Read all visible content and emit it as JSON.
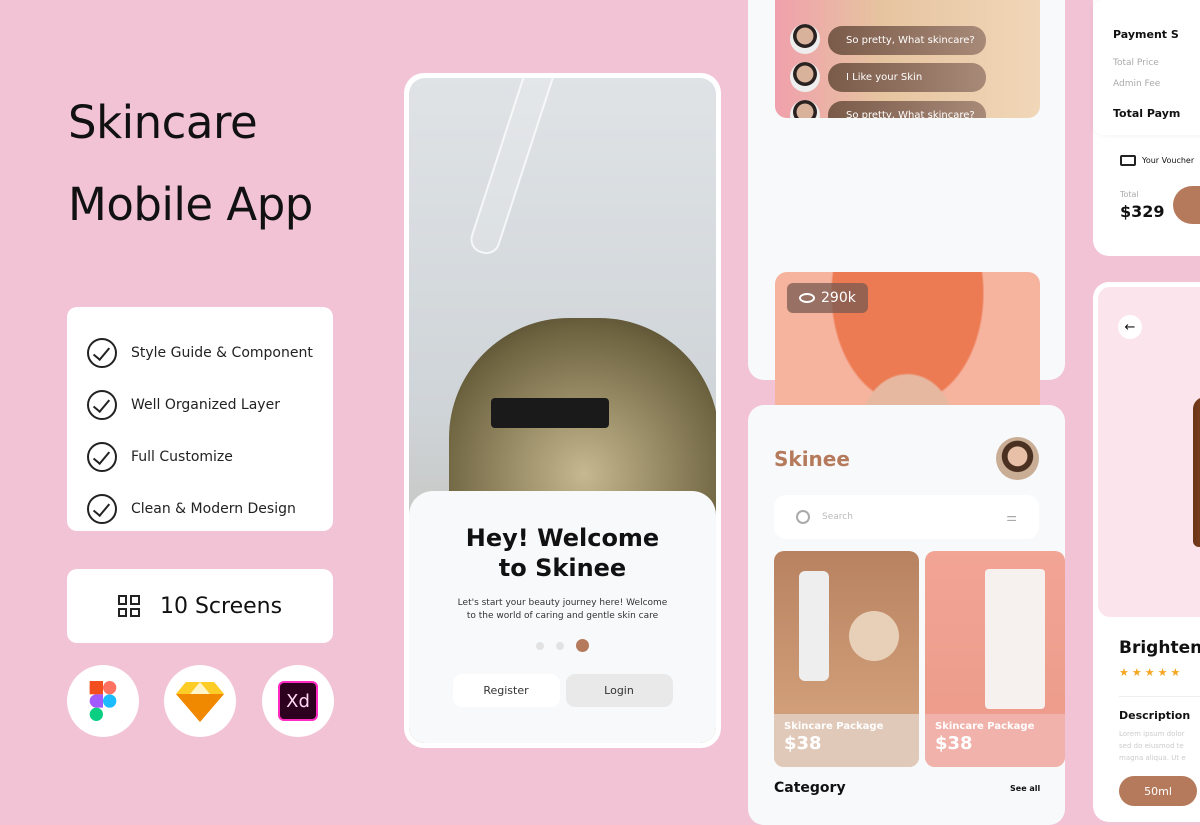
{
  "hero": {
    "title_line1": "Skincare",
    "title_line2": "Mobile App"
  },
  "features": [
    "Style Guide & Component",
    "Well Organized Layer",
    "Full Customize",
    "Clean & Modern Design"
  ],
  "screens_label": "10 Screens",
  "tools": [
    {
      "name": "figma-icon"
    },
    {
      "name": "sketch-icon"
    },
    {
      "name": "xd-icon",
      "label": "Xd"
    }
  ],
  "welcome": {
    "title": "Hey! Welcome to Skinee",
    "subtitle_line1": "Let's start your beauty journey here! Welcome",
    "subtitle_line2": "to the world of caring and gentle skin care",
    "active_dot": 3,
    "register": "Register",
    "login": "Login"
  },
  "live": {
    "comments": [
      "So pretty, What skincare?",
      "I Like your Skin",
      "So pretty, What skincare?"
    ],
    "views": "290k"
  },
  "home": {
    "brand": "Skinee",
    "search_placeholder": "Search",
    "products": [
      {
        "name": "Skincare Package",
        "price": "$38"
      },
      {
        "name": "Skincare Package",
        "price": "$38"
      }
    ],
    "category": "Category",
    "see_all": "See all"
  },
  "payment": {
    "title": "Payment S",
    "total_price": "Total Price",
    "admin_fee": "Admin Fee",
    "total_payment": "Total Paym",
    "voucher": "Your Voucher",
    "total_label": "Total",
    "total": "$329"
  },
  "detail": {
    "title": "Brighteni",
    "rating": 5,
    "description_title": "Description",
    "description": "Lorem ipsum dolor sed do eiusmod te magna aliqua. Ut e",
    "size": "50ml"
  },
  "colors": {
    "background": "#f2c3d5",
    "accent": "#b57a5c"
  }
}
